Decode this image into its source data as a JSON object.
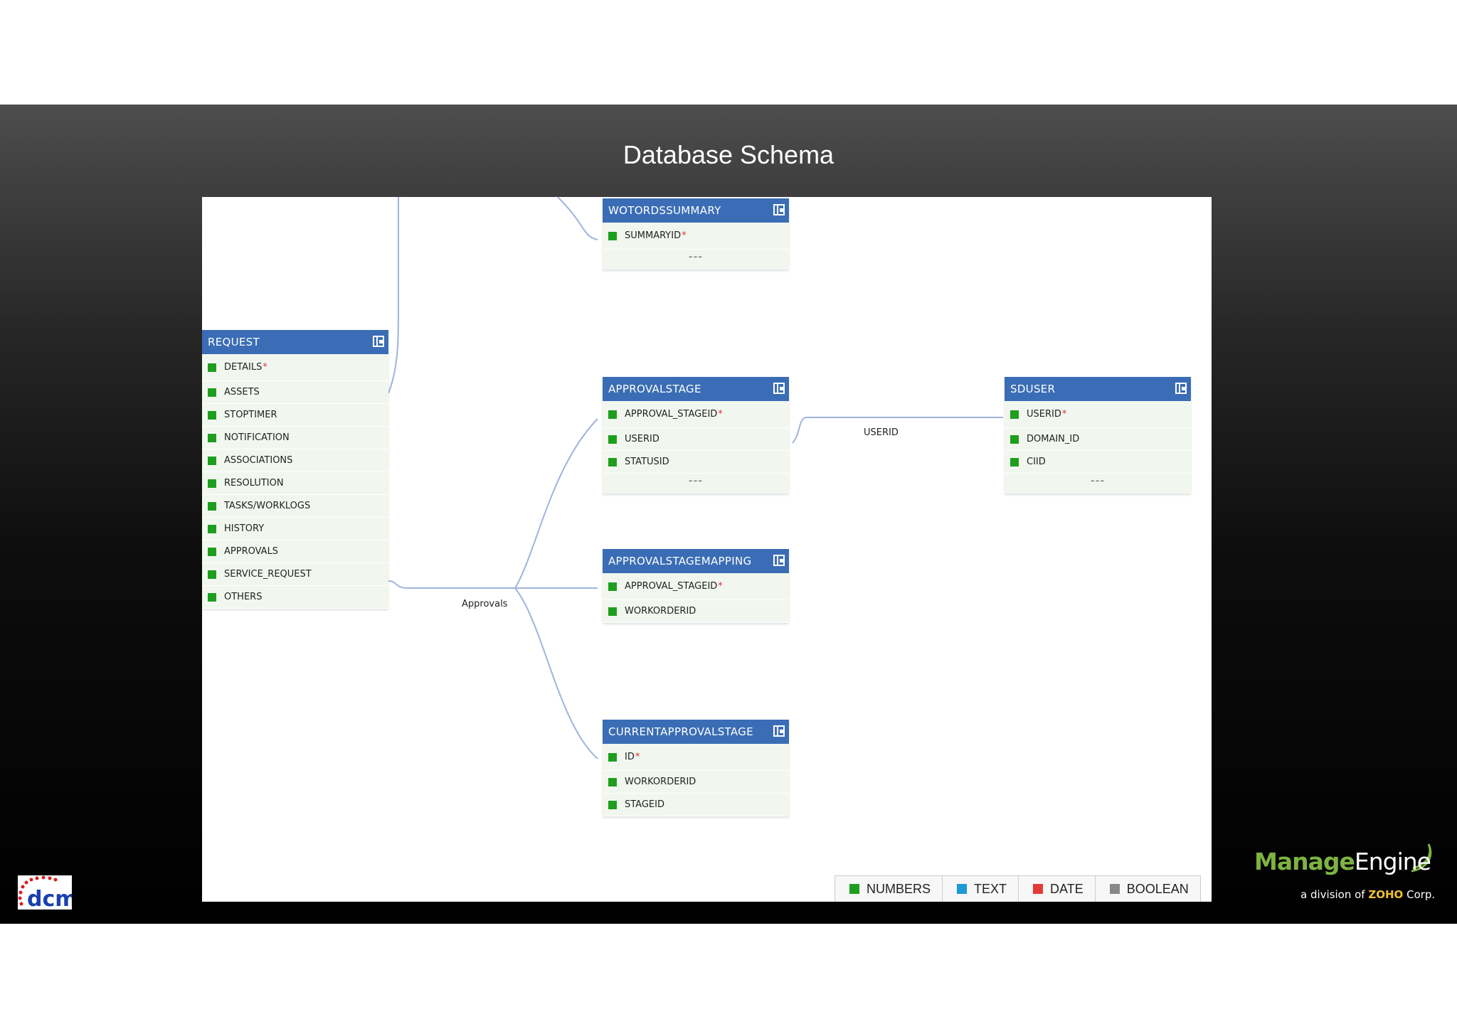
{
  "slide": {
    "title": "Database Schema"
  },
  "tables": {
    "wotordssummary": {
      "name": "WOTORDSSUMMARY",
      "fields": [
        "SUMMARYID"
      ],
      "pk": "*",
      "more": "---"
    },
    "request": {
      "name": "REQUEST",
      "fields": [
        "DETAILS",
        "ASSETS",
        "STOPTIMER",
        "NOTIFICATION",
        "ASSOCIATIONS",
        "RESOLUTION",
        "TASKS/WORKLOGS",
        "HISTORY",
        "APPROVALS",
        "SERVICE_REQUEST",
        "OTHERS"
      ],
      "pk": "*"
    },
    "approvalstage": {
      "name": "APPROVALSTAGE",
      "fields": [
        "APPROVAL_STAGEID",
        "USERID",
        "STATUSID"
      ],
      "pk": "*",
      "more": "---"
    },
    "sduser": {
      "name": "SDUSER",
      "fields": [
        "USERID",
        "DOMAIN_ID",
        "CIID"
      ],
      "pk": "*",
      "more": "---"
    },
    "approvalstagemapping": {
      "name": "APPROVALSTAGEMAPPING",
      "fields": [
        "APPROVAL_STAGEID",
        "WORKORDERID"
      ],
      "pk": "*"
    },
    "currentapprovalstage": {
      "name": "CURRENTAPPROVALSTAGE",
      "fields": [
        "ID",
        "WORKORDERID",
        "STAGEID"
      ],
      "pk": "*"
    }
  },
  "relations": {
    "userid": "USERID",
    "approvals": "Approvals"
  },
  "legend": [
    {
      "label": "NUMBERS",
      "color": "#1e9e1e"
    },
    {
      "label": "TEXT",
      "color": "#1c9ad6"
    },
    {
      "label": "DATE",
      "color": "#e53935"
    },
    {
      "label": "BOOLEAN",
      "color": "#888888"
    }
  ],
  "logos": {
    "dcm": "dcm",
    "manageengine": {
      "brand_a": "Manage",
      "brand_b": "Engine",
      "tagline": "a division of",
      "zoho": "ZOHO",
      "corp": "Corp."
    }
  },
  "colors": {
    "header": "#3a6db5",
    "row_bg": "#f1f7ef",
    "link": "#9fb4dc"
  }
}
